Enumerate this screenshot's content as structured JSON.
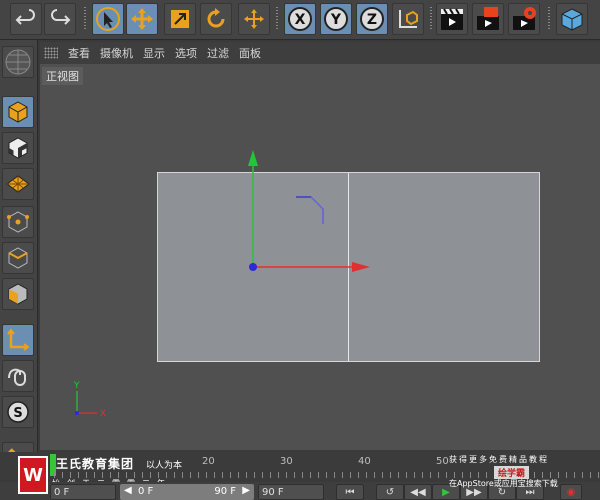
{
  "viewport": {
    "menu": [
      "查看",
      "摄像机",
      "显示",
      "选项",
      "过滤",
      "面板"
    ],
    "view_label": "正视图",
    "axis": {
      "y": "Y",
      "x": "X"
    }
  },
  "toolbar": {
    "axis_x": "X",
    "axis_y": "Y",
    "axis_z": "Z"
  },
  "timeline": {
    "ticks": [
      "20",
      "30",
      "40",
      "50"
    ],
    "start_field": "0 F",
    "range_start": "0 F",
    "range_end": "90 F",
    "end_field": "90 F"
  },
  "watermark": {
    "brand": "王氏教育集团",
    "tagline": "以人为本",
    "subline": "始创于二零零二年",
    "right_line1": "获得更多免费精品教程",
    "right_badge": "绘学霸",
    "right_line2": "在AppStore或应用宝搜索下载",
    "logo_letter": "W"
  },
  "colors": {
    "accent_blue": "#6a8fb3",
    "axis_red": "#e03030",
    "axis_green": "#22c833",
    "axis_blue": "#2b2bd8",
    "orange": "#e8a21d"
  }
}
